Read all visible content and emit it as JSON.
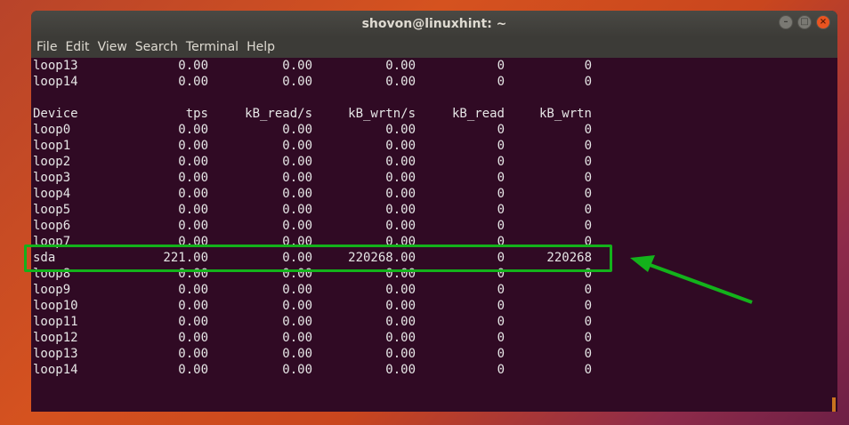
{
  "window": {
    "title": "shovon@linuxhint: ~",
    "menu": [
      "File",
      "Edit",
      "View",
      "Search",
      "Terminal",
      "Help"
    ]
  },
  "terminal": {
    "top_rows": [
      [
        "loop13",
        "0.00",
        "0.00",
        "0.00",
        "0",
        "0"
      ],
      [
        "loop14",
        "0.00",
        "0.00",
        "0.00",
        "0",
        "0"
      ]
    ],
    "header": [
      "Device",
      "tps",
      "kB_read/s",
      "kB_wrtn/s",
      "kB_read",
      "kB_wrtn"
    ],
    "rows": [
      [
        "loop0",
        "0.00",
        "0.00",
        "0.00",
        "0",
        "0"
      ],
      [
        "loop1",
        "0.00",
        "0.00",
        "0.00",
        "0",
        "0"
      ],
      [
        "loop2",
        "0.00",
        "0.00",
        "0.00",
        "0",
        "0"
      ],
      [
        "loop3",
        "0.00",
        "0.00",
        "0.00",
        "0",
        "0"
      ],
      [
        "loop4",
        "0.00",
        "0.00",
        "0.00",
        "0",
        "0"
      ],
      [
        "loop5",
        "0.00",
        "0.00",
        "0.00",
        "0",
        "0"
      ],
      [
        "loop6",
        "0.00",
        "0.00",
        "0.00",
        "0",
        "0"
      ],
      [
        "loop7",
        "0.00",
        "0.00",
        "0.00",
        "0",
        "0"
      ],
      [
        "sda",
        "221.00",
        "0.00",
        "220268.00",
        "0",
        "220268"
      ],
      [
        "loop8",
        "0.00",
        "0.00",
        "0.00",
        "0",
        "0"
      ],
      [
        "loop9",
        "0.00",
        "0.00",
        "0.00",
        "0",
        "0"
      ],
      [
        "loop10",
        "0.00",
        "0.00",
        "0.00",
        "0",
        "0"
      ],
      [
        "loop11",
        "0.00",
        "0.00",
        "0.00",
        "0",
        "0"
      ],
      [
        "loop12",
        "0.00",
        "0.00",
        "0.00",
        "0",
        "0"
      ],
      [
        "loop13",
        "0.00",
        "0.00",
        "0.00",
        "0",
        "0"
      ],
      [
        "loop14",
        "0.00",
        "0.00",
        "0.00",
        "0",
        "0"
      ]
    ]
  },
  "annotation": {
    "color": "#13b21b",
    "highlighted_device": "sda"
  }
}
